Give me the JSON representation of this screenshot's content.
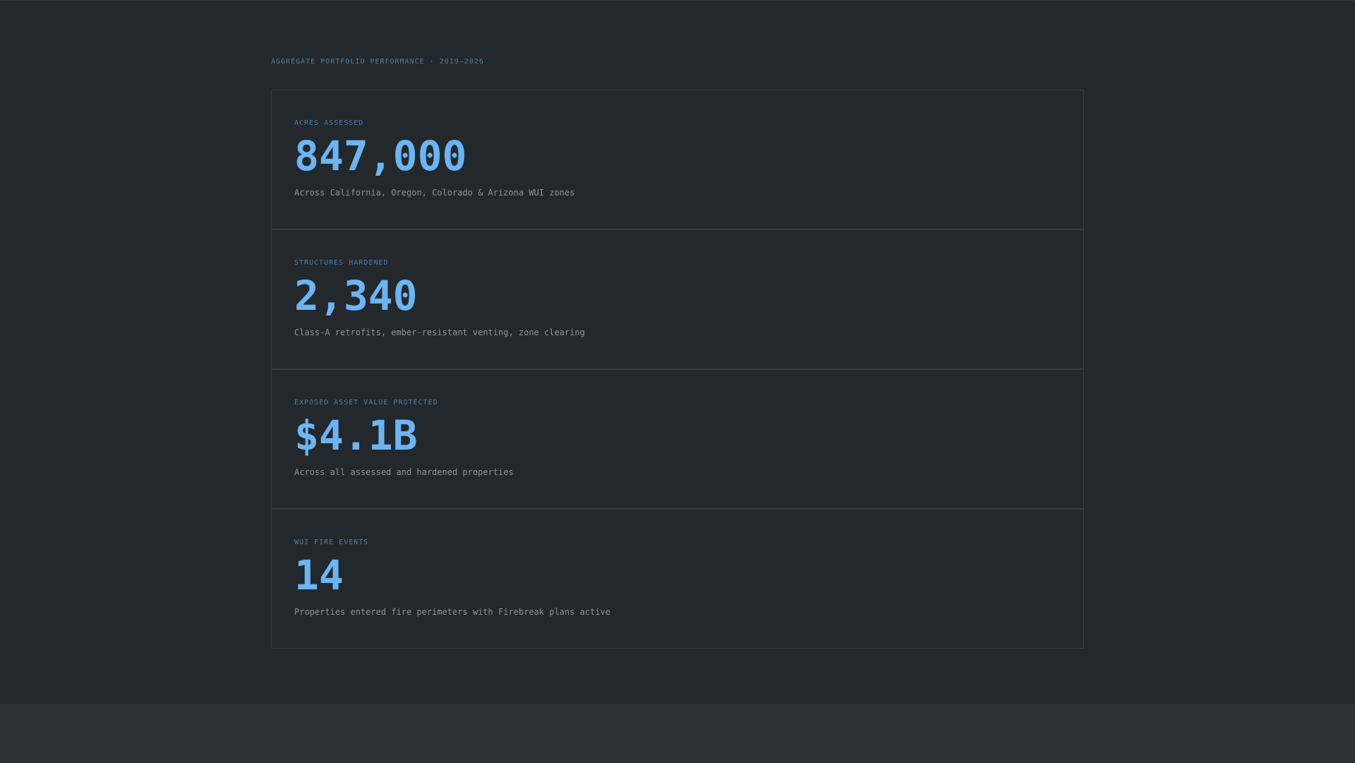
{
  "section": {
    "title": "AGGREGATE PORTFOLIO PERFORMANCE · 2019–2026"
  },
  "metrics": [
    {
      "label": "ACRES ASSESSED",
      "value": "847,000",
      "description": "Across California, Oregon, Colorado & Arizona WUI zones"
    },
    {
      "label": "STRUCTURES HARDENED",
      "value": "2,340",
      "description": "Class-A retrofits, ember-resistant venting, zone clearing"
    },
    {
      "label": "EXPOSED ASSET VALUE PROTECTED",
      "value": "$4.1B",
      "description": "Across all assessed and hardened properties"
    },
    {
      "label": "WUI FIRE EVENTS",
      "value": "14",
      "description": "Properties entered fire perimeters with Firebreak plans active"
    }
  ],
  "colors": {
    "background": "#23282c",
    "accent_value": "#6cb4f2",
    "accent_label": "#4f7fa8",
    "description": "#8e9499",
    "border": "#363c41",
    "footer": "#2b3134"
  }
}
